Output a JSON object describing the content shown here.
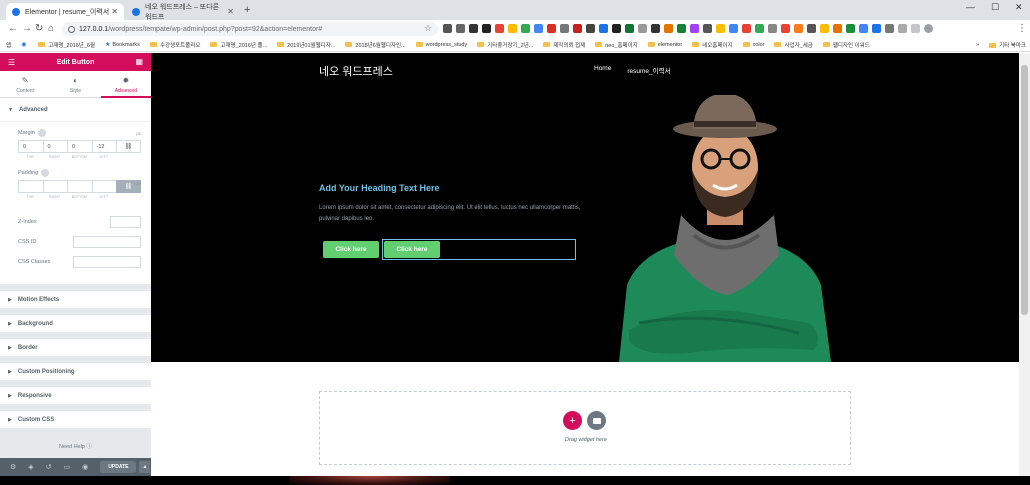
{
  "browser": {
    "tabs": [
      {
        "label": "Elementor | resume_이력서",
        "active": true
      },
      {
        "label": "네오 워드프레스 – 또다른 워드프",
        "active": false
      }
    ],
    "url_host": "127.0.0.1",
    "url_path": "/wordpress/tempate/wp-admin/post.php?post=92&action=elementor#",
    "bookmarks": [
      "앱",
      "",
      "고재명_2016년_6월",
      "Bookmarks",
      "수강생포트폴리오",
      "고재명_2016년 졸...",
      "2019년01월웹디자...",
      "2018년6월웹디자인...",
      "wordpress_study",
      "기타좋거장기_2년...",
      "제작의뢰 접제",
      "neo_홈페이지",
      "elementor",
      "네오홈페이지",
      "color",
      "사업자_세금",
      "웹디자인 이워드"
    ],
    "bookmark_other": "기타 북마크",
    "bookmark_overflow": "»"
  },
  "panel": {
    "title": "Edit Button",
    "tabs": [
      {
        "label": "Content",
        "icon": "pencil-icon"
      },
      {
        "label": "Style",
        "icon": "contrast-icon"
      },
      {
        "label": "Advanced",
        "icon": "gear-icon",
        "active": true
      }
    ],
    "advanced": {
      "title": "Advanced",
      "margin_label": "Margin",
      "margin_unit": "px",
      "margin_values": [
        "0",
        "0",
        "0",
        "-12"
      ],
      "dim_labels": [
        "TOP",
        "RIGHT",
        "BOTTOM",
        "LEFT"
      ],
      "padding_label": "Padding",
      "padding_unit": "EM",
      "padding_values": [
        "",
        "",
        "",
        ""
      ],
      "zindex_label": "Z-Index",
      "cssid_label": "CSS ID",
      "cssclasses_label": "CSS Classes"
    },
    "sections": [
      "Motion Effects",
      "Background",
      "Border",
      "Custom Positioning",
      "Responsive",
      "Custom CSS"
    ],
    "need_help": "Need Help",
    "update_label": "UPDATE"
  },
  "site": {
    "title": "네오 워드프레스",
    "nav": [
      "Home",
      "resume_이력서"
    ],
    "heading": "Add Your Heading Text Here",
    "text": "Lorem ipsum dolor sit amet, consectetur adipiscing elit. Ut elit tellus, luctus nec ullamcorper mattis, pulvinar dapibus leo.",
    "button1": "Click here",
    "button2": "Click here",
    "drag_widget": "Drag widget here"
  },
  "colors": {
    "elementor_pink": "#d30c5c",
    "heading_blue": "#6ec1e4",
    "button_green": "#61ce70",
    "person_sweater": "#1e8a5a"
  }
}
